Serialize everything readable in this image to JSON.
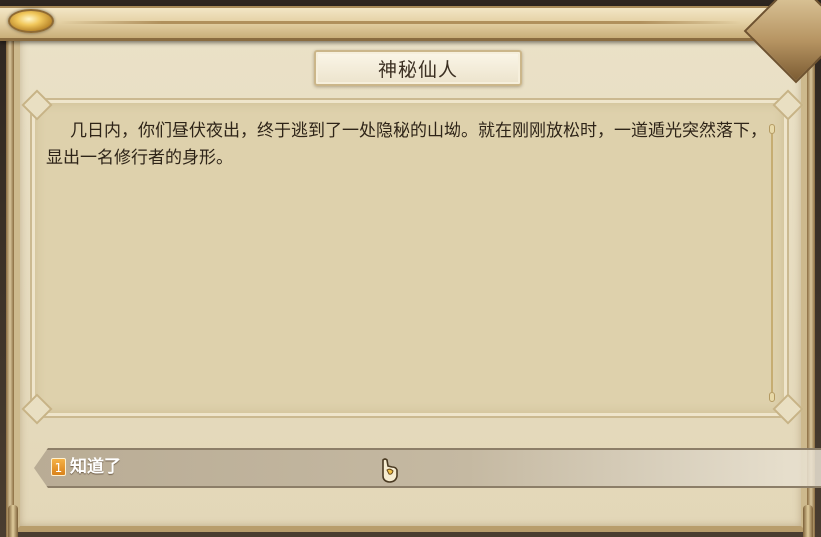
{
  "dialog": {
    "title": "神秘仙人",
    "body": "几日内，你们昼伏夜出，终于逃到了一处隐秘的山坳。就在刚刚放松时，一道遁光突然落下，显出一名修行者的身形。",
    "options": [
      {
        "number": "1",
        "label": "知道了"
      }
    ]
  },
  "icons": {
    "cursor": "hand-pointer-icon",
    "gem": "gold-gem-icon",
    "corner": "frame-corner-ornament-icon"
  },
  "colors": {
    "panel_bg": "#e3d7b8",
    "text_box_bg": "#ded1ac",
    "option_bar": "#c5b9a2",
    "option_badge": "#e8962c",
    "title_text": "#3b2f22"
  }
}
